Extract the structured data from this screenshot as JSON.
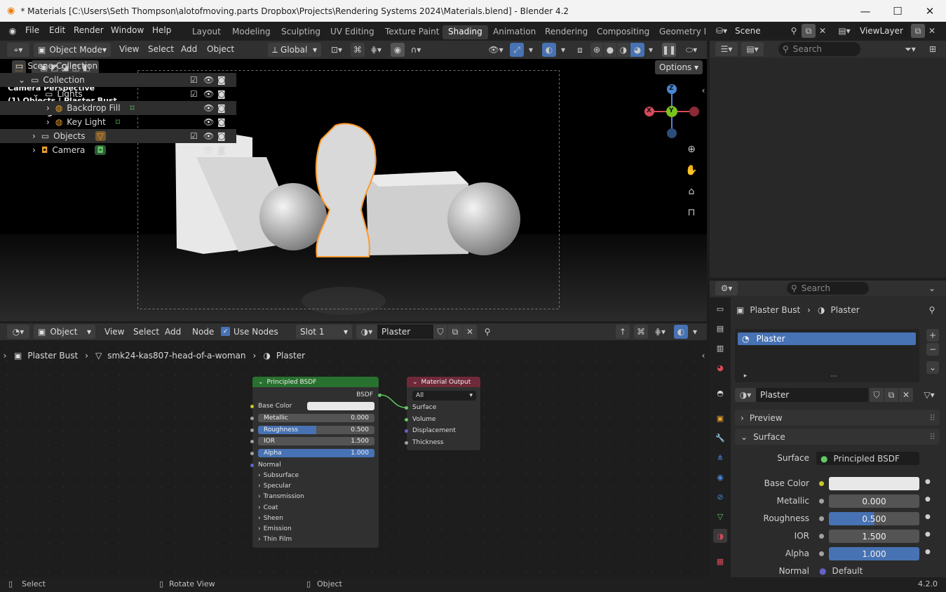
{
  "window": {
    "title": "* Materials [C:\\Users\\Seth Thompson\\alotofmoving.parts Dropbox\\Projects\\Rendering Systems 2024\\Materials.blend] - Blender 4.2"
  },
  "menu": [
    "File",
    "Edit",
    "Render",
    "Window",
    "Help"
  ],
  "workspaces": [
    "Layout",
    "Modeling",
    "Sculpting",
    "UV Editing",
    "Texture Paint",
    "Shading",
    "Animation",
    "Rendering",
    "Compositing",
    "Geometry N"
  ],
  "active_workspace": "Shading",
  "scene": {
    "name": "Scene",
    "view_layer": "ViewLayer"
  },
  "viewport_header": {
    "mode": "Object Mode",
    "menus": [
      "View",
      "Select",
      "Add",
      "Object"
    ],
    "orientation": "Global",
    "options": "Options"
  },
  "viewport_overlay": {
    "line1": "Camera Perspective",
    "line2": "(1) Objects | Plaster Bust",
    "line3": "Rendering Done"
  },
  "gizmo": {
    "z": "Z",
    "y": "Y",
    "x": "X"
  },
  "node_header": {
    "editor": "Object",
    "menus": [
      "View",
      "Select",
      "Add",
      "Node"
    ],
    "use_nodes": "Use Nodes",
    "slot": "Slot 1",
    "material": "Plaster"
  },
  "breadcrumb": {
    "object": "Plaster Bust",
    "mesh": "smk24-kas807-head-of-a-woman",
    "material": "Plaster"
  },
  "principled": {
    "title": "Principled BSDF",
    "output": "BSDF",
    "base_color": "Base Color",
    "sliders": [
      {
        "label": "Metallic",
        "value": "0.000",
        "fill": 0
      },
      {
        "label": "Roughness",
        "value": "0.500",
        "fill": 0.5
      },
      {
        "label": "IOR",
        "value": "1.500",
        "fill": 0
      },
      {
        "label": "Alpha",
        "value": "1.000",
        "fill": 1
      }
    ],
    "normal": "Normal",
    "panels": [
      "Subsurface",
      "Specular",
      "Transmission",
      "Coat",
      "Sheen",
      "Emission",
      "Thin Film"
    ]
  },
  "material_output": {
    "title": "Material Output",
    "target": "All",
    "inputs": [
      "Surface",
      "Volume",
      "Displacement",
      "Thickness"
    ]
  },
  "outliner": {
    "search_placeholder": "Search",
    "items": [
      {
        "label": "Scene Collection"
      },
      {
        "label": "Collection"
      },
      {
        "label": "Lights"
      },
      {
        "label": "Backdrop Fill"
      },
      {
        "label": "Key Light"
      },
      {
        "label": "Objects"
      },
      {
        "label": "Camera"
      }
    ]
  },
  "properties": {
    "search_placeholder": "Search",
    "object": "Plaster Bust",
    "material": "Plaster",
    "slot_item": "Plaster",
    "material_field": "Plaster",
    "preview": "Preview",
    "surface_panel": "Surface",
    "rows": [
      {
        "label": "Surface",
        "value": "Principled BSDF"
      },
      {
        "label": "Base Color",
        "value": ""
      },
      {
        "label": "Metallic",
        "value": "0.000",
        "fill": 0
      },
      {
        "label": "Roughness",
        "value": "0.500",
        "fill": 0.5
      },
      {
        "label": "IOR",
        "value": "1.500",
        "fill": 0
      },
      {
        "label": "Alpha",
        "value": "1.000",
        "fill": 1
      },
      {
        "label": "Normal",
        "value": "Default"
      }
    ]
  },
  "statusbar": {
    "select": "Select",
    "rotate": "Rotate View",
    "object": "Object",
    "version": "4.2.0"
  },
  "colors": {
    "accent": "#4772b3",
    "shader_header": "#29712e",
    "output_header": "#6e2a39",
    "selection_outline": "#ff9a2e"
  }
}
